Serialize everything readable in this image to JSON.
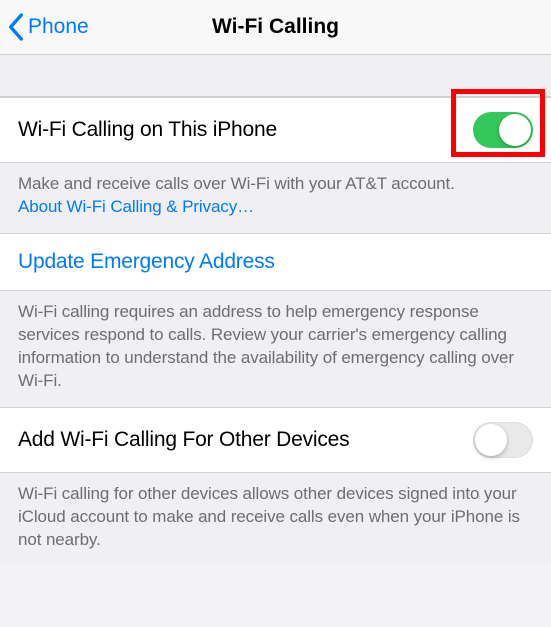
{
  "nav": {
    "back_label": "Phone",
    "title": "Wi-Fi Calling"
  },
  "wifi_calling_this_phone": {
    "label": "Wi-Fi Calling on This iPhone",
    "enabled": true
  },
  "wifi_calling_footer": {
    "text": "Make and receive calls over Wi-Fi with your AT&T account.",
    "link": "About Wi-Fi Calling & Privacy…"
  },
  "update_emergency": {
    "label": "Update Emergency Address"
  },
  "emergency_footer": {
    "text": "Wi-Fi calling requires an address to help emergency response services respond to calls. Review your carrier's emergency calling information to understand the availability of emergency calling over Wi-Fi."
  },
  "other_devices": {
    "label": "Add Wi-Fi Calling For Other Devices",
    "enabled": false
  },
  "other_devices_footer": {
    "text": "Wi-Fi calling for other devices allows other devices signed into your iCloud account to make and receive calls even when your iPhone is not nearby."
  },
  "highlight": {
    "color": "#ff0000"
  }
}
